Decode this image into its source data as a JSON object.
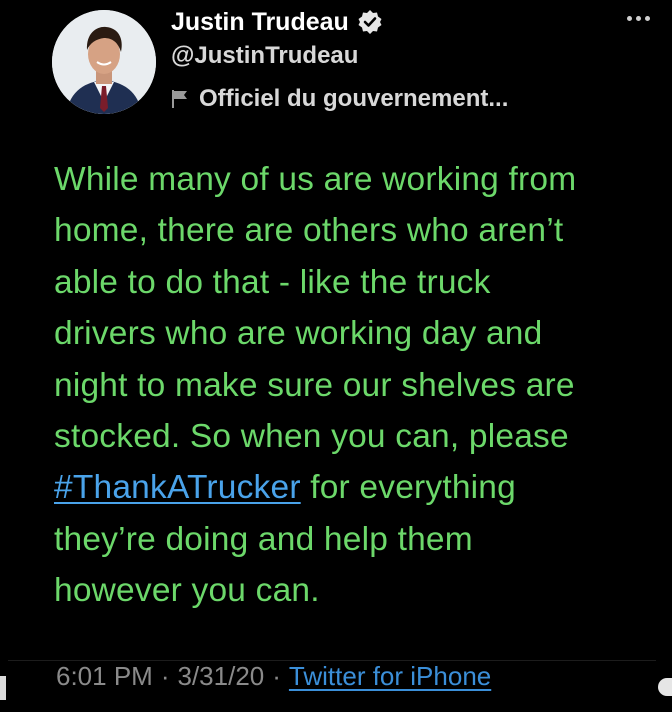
{
  "author": {
    "display_name": "Justin Trudeau",
    "handle": "@JustinTrudeau",
    "label": "Officiel du gouvernement...",
    "avatar_icon": "profile-photo",
    "verified_icon": "verified-badge-icon"
  },
  "tweet": {
    "lines": [
      "While many of us are working from",
      "home, there are others who aren’t",
      "able to do that - like the truck",
      "drivers who are working day and",
      "night to make sure our shelves are",
      "stocked. So when you can, please"
    ],
    "hashtag": "#ThankATrucker",
    "after_hashtag": " for everything",
    "closing_lines": [
      "they’re doing and help them",
      "however you can."
    ]
  },
  "meta": {
    "time": "6:01 PM",
    "separator": "·",
    "date": "3/31/20",
    "source": "Twitter for iPhone"
  },
  "colors": {
    "background": "#000000",
    "tweet_text": "#6cd86a",
    "hashtag": "#4aa3ea",
    "source_link": "#3b8fd9",
    "meta_text": "#8a8a8a"
  }
}
